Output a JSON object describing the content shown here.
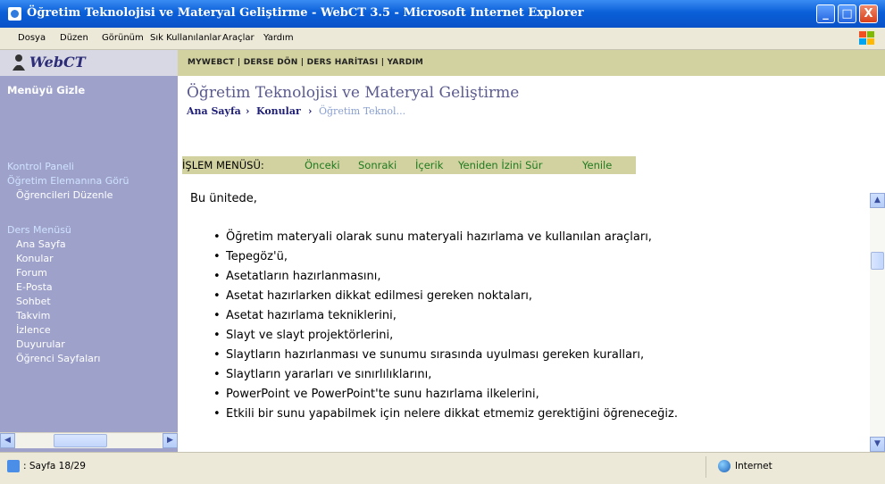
{
  "window": {
    "title": "Öğretim Teknolojisi ve Materyal Geliştirme - WebCT 3.5 - Microsoft Internet Explorer",
    "controls": {
      "minimize": "_",
      "maximize": "□",
      "close": "X"
    }
  },
  "menubar": {
    "items": [
      "Dosya",
      "Düzen",
      "Görünüm",
      "Sık Kullanılanlar",
      "Araçlar",
      "Yardım"
    ]
  },
  "sidebar": {
    "logo_text": "WebCT",
    "hide_menu": "Menüyü Gizle",
    "control_panel": "Kontrol Paneli",
    "instructor_view": "Öğretim Elemanına Görü",
    "edit_students": "Öğrencileri Düzenle",
    "course_menu": "Ders Menüsü",
    "course_items": [
      "Ana Sayfa",
      "Konular",
      "Forum",
      "E-Posta",
      "Sohbet",
      "Takvim",
      "İzlence",
      "Duyurular",
      "Öğrenci Sayfaları"
    ]
  },
  "topnav": {
    "text": "MYWEBCT | DERSE DÖN | DERS HARİTASI | YARDIM"
  },
  "main": {
    "course_title": "Öğretim Teknolojisi ve Materyal Geliştirme",
    "breadcrumb": {
      "home": "Ana Sayfa",
      "sep": "›",
      "topics": "Konular",
      "current": "Öğretim Teknol..."
    },
    "operations": {
      "label": "İŞLEM MENÜSÜ:",
      "links": [
        "Önceki",
        "Sonraki",
        "İçerik",
        "Yeniden İzini Sür",
        "Yenile"
      ]
    },
    "intro": "Bu ünitede,",
    "bullets": [
      "Öğretim materyali olarak sunu materyali hazırlama ve kullanılan araçları,",
      "Tepegöz'ü,",
      "Asetatların hazırlanmasını,",
      "Asetat hazırlarken dikkat edilmesi gereken noktaları,",
      "Asetat hazırlama tekniklerini,",
      "Slayt ve slayt projektörlerini,",
      "Slaytların hazırlanması ve sunumu sırasında uyulması gereken kuralları,",
      "Slaytların yararları ve sınırlılıklarını,",
      "PowerPoint ve PowerPoint'te sunu hazırlama ilkelerini,",
      "Etkili bir sunu yapabilmek için nelere dikkat etmemiz gerektiğini öğreneceğiz."
    ]
  },
  "status": {
    "page": ": Sayfa 18/29",
    "zone": "Internet"
  },
  "colors": {
    "sidebar": "#9ea2cb",
    "nav_bar": "#d2d2a0",
    "link_green": "#1f7a1f",
    "title_blue": "#5a5a8e"
  }
}
